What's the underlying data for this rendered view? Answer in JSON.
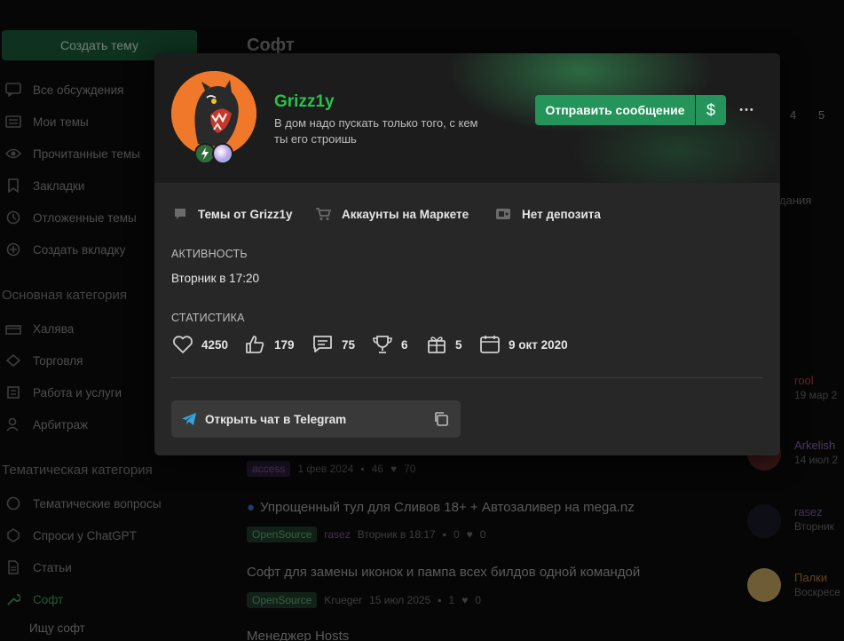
{
  "background": {
    "create_topic": "Создать тему",
    "page_title": "Софт",
    "pages": [
      "4",
      "5"
    ],
    "side_fragment": "дания",
    "sidebar_items": [
      {
        "label": "Все обсуждения",
        "icon": "chat-icon"
      },
      {
        "label": "Мои темы",
        "icon": "list-icon"
      },
      {
        "label": "Прочитанные темы",
        "icon": "eye-icon"
      },
      {
        "label": "Закладки",
        "icon": "bookmark-icon"
      },
      {
        "label": "Отложенные темы",
        "icon": "clock-icon"
      },
      {
        "label": "Создать вкладку",
        "icon": "plus-icon"
      }
    ],
    "category_main": "Основная категория",
    "main_items": [
      {
        "label": "Халява",
        "icon": "gift-icon"
      },
      {
        "label": "Торговля",
        "icon": "trade-icon"
      },
      {
        "label": "Работа и услуги",
        "icon": "briefcase-icon"
      },
      {
        "label": "Арбитраж",
        "icon": "user-icon"
      }
    ],
    "category_thematic": "Тематическая категория",
    "thematic_items": [
      {
        "label": "Тематические вопросы",
        "icon": "question-icon"
      },
      {
        "label": "Спроси у ChatGPT",
        "icon": "robot-icon"
      },
      {
        "label": "Статьи",
        "icon": "document-icon"
      },
      {
        "label": "Софт",
        "icon": "wrench-icon"
      }
    ],
    "sub_item": "Ищу софт",
    "threads": [
      {
        "title": "",
        "tag": "access",
        "author": "",
        "date": "1 фев 2024",
        "replies": "46",
        "likes": "70"
      },
      {
        "title": "Упрощенный тул для Сливов 18+ + Автозаливер на mega.nz",
        "tag": "OpenSource",
        "author": "rasez",
        "date": "Вторник в 18:17",
        "replies": "0",
        "likes": "0"
      },
      {
        "title": "Софт для замены иконок и пампа всех билдов одной командой",
        "tag": "OpenSource",
        "author": "Krueger",
        "date": "15 июл 2025",
        "replies": "1",
        "likes": "0"
      },
      {
        "title": "Менеджер Hosts",
        "tag": "",
        "author": "",
        "date": "",
        "replies": "",
        "likes": ""
      }
    ],
    "right_users": [
      {
        "name": "rool",
        "date": "19 мар 2"
      },
      {
        "name": "Arkelish",
        "date": "14 июл 2"
      },
      {
        "name": "rasez",
        "date": "Вторник"
      },
      {
        "name": "Палки",
        "date": "Воскресе"
      }
    ]
  },
  "profile": {
    "username": "Grizz1y",
    "status": "В дом надо пускать только того, с кем ты его строишь",
    "send_message": "Отправить сообщение",
    "money_symbol": "$",
    "more_symbol": "•••",
    "links": [
      {
        "label": "Темы от Grizz1y",
        "icon": "chat-bubble-icon"
      },
      {
        "label": "Аккаунты на Маркете",
        "icon": "cart-icon"
      },
      {
        "label": "Нет депозита",
        "icon": "deposit-icon"
      }
    ],
    "activity_label": "Активность",
    "activity_value": "Вторник в 17:20",
    "stats_label": "Статистика",
    "stats": [
      {
        "icon": "heart-icon",
        "value": "4250"
      },
      {
        "icon": "thumbs-up-icon",
        "value": "179"
      },
      {
        "icon": "message-icon",
        "value": "75"
      },
      {
        "icon": "trophy-icon",
        "value": "6"
      },
      {
        "icon": "gift-icon",
        "value": "5"
      },
      {
        "icon": "calendar-icon",
        "value": "9 окт 2020"
      }
    ],
    "telegram_button": "Открыть чат в Telegram"
  },
  "colors": {
    "accent_green": "#24945a",
    "username_green": "#27c24c",
    "card_bg": "#272727",
    "header_bg": "#1c1c1c",
    "avatar_orange": "#f0782a"
  }
}
